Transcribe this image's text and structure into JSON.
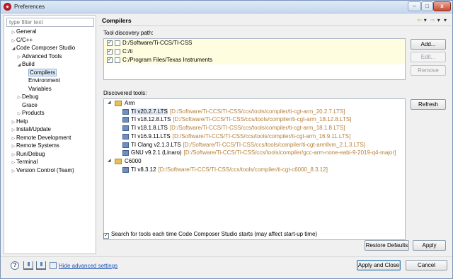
{
  "window": {
    "title": "Preferences",
    "controls": {
      "minimize": "–",
      "maximize": "□",
      "close": "x"
    }
  },
  "sidebar": {
    "filter_placeholder": "type filter text",
    "items": [
      {
        "label": "General",
        "level": 0,
        "arrow": "▷"
      },
      {
        "label": "C/C++",
        "level": 0,
        "arrow": "▷"
      },
      {
        "label": "Code Composer Studio",
        "level": 0,
        "arrow": "◢"
      },
      {
        "label": "Advanced Tools",
        "level": 1,
        "arrow": "▷"
      },
      {
        "label": "Build",
        "level": 1,
        "arrow": "◢"
      },
      {
        "label": "Compilers",
        "level": 2,
        "arrow": "",
        "selected": true
      },
      {
        "label": "Environment",
        "level": 2,
        "arrow": ""
      },
      {
        "label": "Variables",
        "level": 2,
        "arrow": ""
      },
      {
        "label": "Debug",
        "level": 1,
        "arrow": "▷"
      },
      {
        "label": "Grace",
        "level": 1,
        "arrow": ""
      },
      {
        "label": "Products",
        "level": 1,
        "arrow": "▷"
      },
      {
        "label": "Help",
        "level": 0,
        "arrow": "▷"
      },
      {
        "label": "Install/Update",
        "level": 0,
        "arrow": "▷"
      },
      {
        "label": "Remote Development",
        "level": 0,
        "arrow": "▷"
      },
      {
        "label": "Remote Systems",
        "level": 0,
        "arrow": "▷"
      },
      {
        "label": "Run/Debug",
        "level": 0,
        "arrow": "▷"
      },
      {
        "label": "Terminal",
        "level": 0,
        "arrow": "▷"
      },
      {
        "label": "Version Control (Team)",
        "level": 0,
        "arrow": "▷"
      }
    ]
  },
  "page": {
    "title": "Compilers",
    "nav": {
      "back": "⇦",
      "back_menu": "▾",
      "forward": "⇨",
      "forward_menu": "▾",
      "view_menu": "▾"
    },
    "discovery": {
      "label": "Tool discovery path:",
      "paths": [
        {
          "checked": true,
          "path": "D:/Software/Ti-CCS/TI-CSS"
        },
        {
          "checked": true,
          "path": "C:/ti"
        },
        {
          "checked": true,
          "path": "C:/Program Files/Texas Instruments"
        }
      ],
      "buttons": {
        "add": "Add...",
        "edit": "Edit...",
        "remove": "Remove"
      }
    },
    "discovered": {
      "label": "Discovered tools:",
      "refresh": "Refresh",
      "groups": [
        {
          "name": "Arm",
          "arrow": "◢",
          "tools": [
            {
              "name": "TI v20.2.7.LTS",
              "path": "[D:/Software/Ti-CCS/TI-CSS/ccs/tools/compiler/ti-cgt-arm_20.2.7.LTS]"
            },
            {
              "name": "TI v18.12.8.LTS",
              "path": "[D:/Software/Ti-CCS/TI-CSS/ccs/tools/compiler/ti-cgt-arm_18.12.8.LTS]"
            },
            {
              "name": "TI v18.1.8.LTS",
              "path": "[D:/Software/Ti-CCS/TI-CSS/ccs/tools/compiler/ti-cgt-arm_18.1.8.LTS]"
            },
            {
              "name": "TI v16.9.11.LTS",
              "path": "[D:/Software/Ti-CCS/TI-CSS/ccs/tools/compiler/ti-cgt-arm_16.9.11.LTS]"
            },
            {
              "name": "TI Clang v2.1.3.LTS",
              "path": "[D:/Software/Ti-CCS/TI-CSS/ccs/tools/compiler/ti-cgt-armllvm_2.1.3.LTS]"
            },
            {
              "name": "GNU v9.2.1 (Linaro)",
              "path": "[D:/Software/Ti-CCS/TI-CSS/ccs/tools/compiler/gcc-arm-none-eabi-9-2019-q4-major]"
            }
          ]
        },
        {
          "name": "C6000",
          "arrow": "◢",
          "tools": [
            {
              "name": "TI v8.3.12",
              "path": "[D:/Software/Ti-CCS/TI-CSS/ccs/tools/compiler/ti-cgt-c6000_8.3.12]"
            }
          ]
        }
      ]
    },
    "search_each_start": {
      "checked": true,
      "label": "Search for tools each time Code Composer Studio starts (may affect start-up time)"
    },
    "restore_defaults": "Restore Defaults",
    "apply": "Apply"
  },
  "footer": {
    "help_icon": "?",
    "hide_advanced": "Hide advanced settings",
    "apply_and_close": "Apply and Close",
    "cancel": "Cancel"
  },
  "icons": {
    "checkmark": "✓"
  }
}
